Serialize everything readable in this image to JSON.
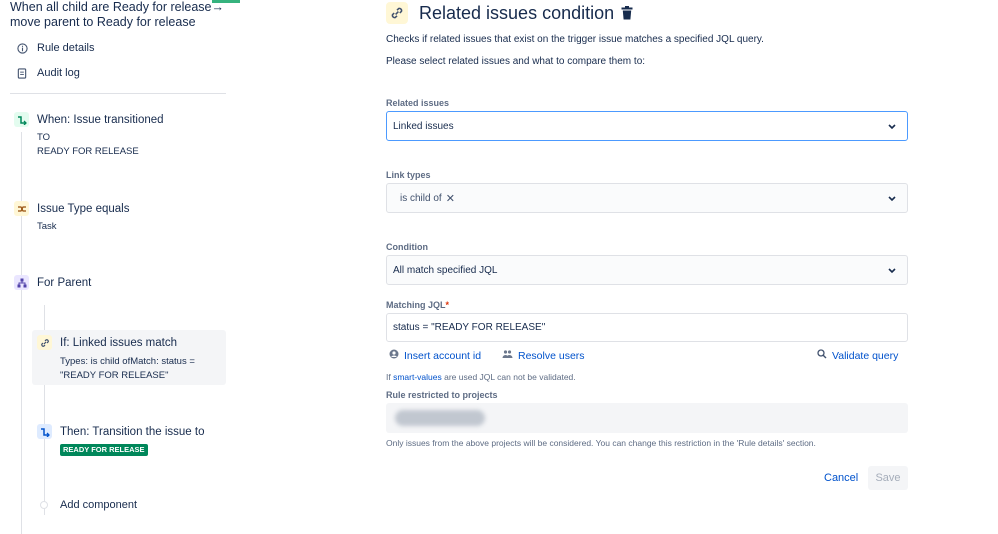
{
  "rule": {
    "title": "When all child are Ready for release→ move parent to Ready for release"
  },
  "nav": {
    "rule_details": "Rule details",
    "audit_log": "Audit log"
  },
  "components": {
    "trigger": {
      "title": "When: Issue transitioned",
      "line1": "TO",
      "line2": "READY FOR RELEASE"
    },
    "condition": {
      "title": "Issue Type equals",
      "sub": "Task"
    },
    "branch": {
      "title": "For Parent"
    },
    "if_block": {
      "title": "If: Linked issues match",
      "sub1": "Types: is child ofMatch: status =",
      "sub2": "\"READY FOR RELEASE\""
    },
    "action": {
      "title": "Then: Transition the issue to",
      "status": "READY FOR RELEASE"
    },
    "add": "Add component"
  },
  "panel": {
    "title": "Related issues condition",
    "desc1": "Checks if related issues that exist on the trigger issue matches a specified JQL query.",
    "desc2": "Please select related issues and what to compare them to:",
    "related_label": "Related issues",
    "related_value": "Linked issues",
    "link_types_label": "Link types",
    "link_chip": "is child of",
    "condition_label": "Condition",
    "condition_value": "All match specified JQL",
    "jql_label": "Matching JQL",
    "jql_required": "*",
    "jql_value": "status = \"READY FOR RELEASE\"",
    "insert_account": "Insert account id",
    "resolve_users": "Resolve users",
    "validate": "Validate query",
    "hint_prefix": "If ",
    "hint_link": "smart-values",
    "hint_suffix": " are used JQL can not be validated.",
    "restricted_label": "Rule restricted to projects",
    "restricted_note": "Only issues from the above projects will be considered. You can change this restriction in the 'Rule details' section.",
    "cancel": "Cancel",
    "save": "Save"
  },
  "colors": {
    "accent_green": "#36b37e",
    "status_green": "#00875a",
    "link_blue": "#0052cc",
    "focus_blue": "#4c9aff"
  }
}
